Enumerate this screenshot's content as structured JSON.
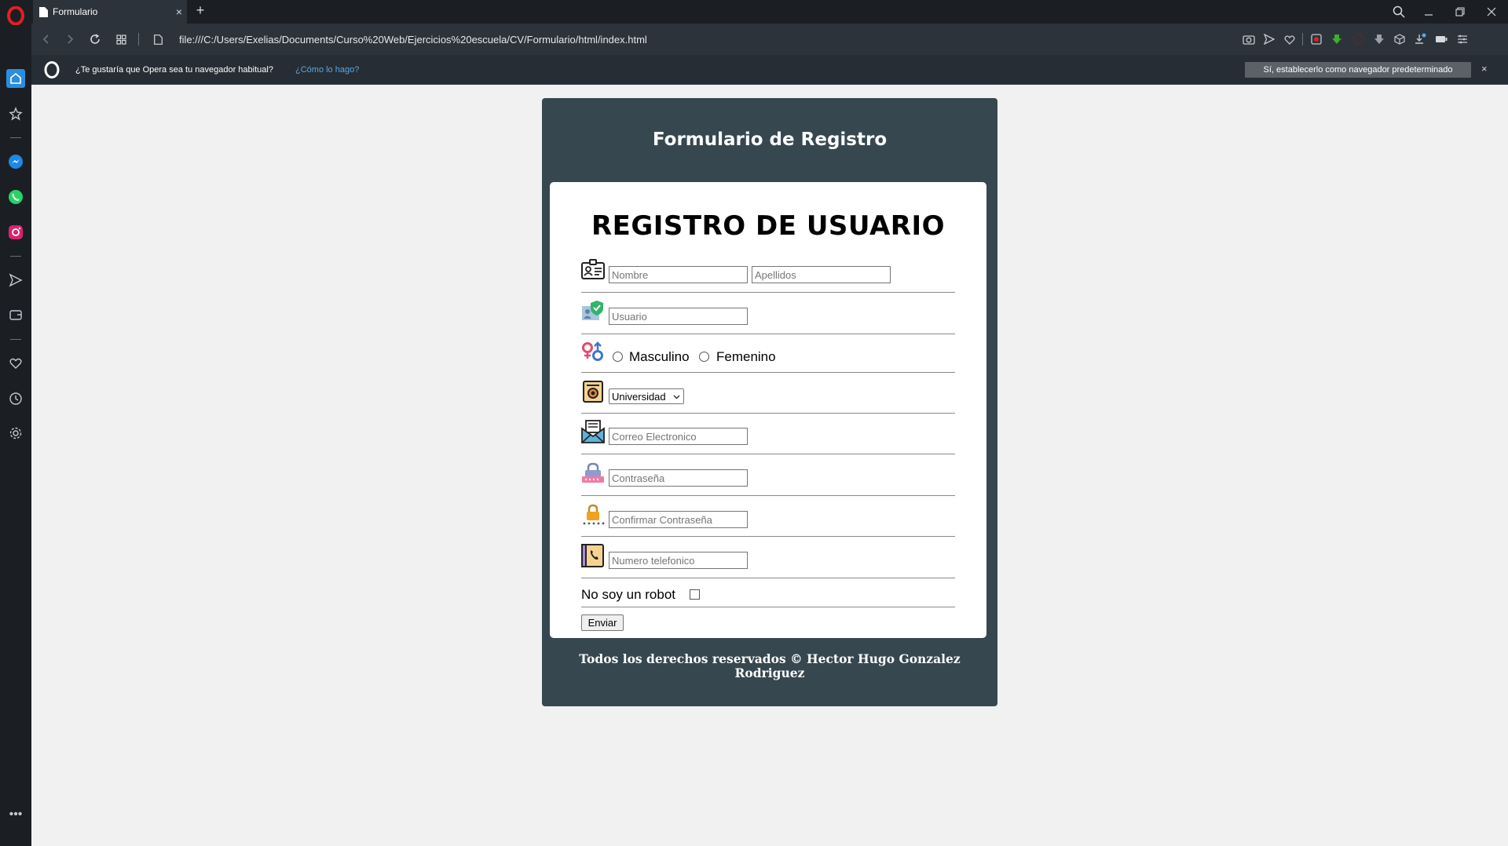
{
  "browser": {
    "tab_title": "Formulario",
    "tab_close": "×",
    "new_tab": "+",
    "url": "file:///C:/Users/Exelias/Documents/Curso%20Web/Ejercicios%20escuela/CV/Formulario/html/index.html",
    "accent_color": "#e21f26"
  },
  "infobar": {
    "message": "¿Te gustaría que Opera sea tu navegador habitual?",
    "link": "¿Cómo lo hago?",
    "default_button": "Sí, establecerlo como navegador predeterminado",
    "close": "×"
  },
  "page": {
    "card_title": "Formulario de Registro",
    "form_heading": "REGISTRO DE USUARIO",
    "fields": {
      "nombre_placeholder": "Nombre",
      "apellidos_placeholder": "Apellidos",
      "usuario_placeholder": "Usuario",
      "gender_options": [
        "Masculino",
        "Femenino"
      ],
      "university_selected": "Universidad",
      "email_placeholder": "Correo Electronico",
      "password_placeholder": "Contraseña",
      "confirm_password_placeholder": "Confirmar Contraseña",
      "phone_placeholder": "Numero telefonico"
    },
    "robot_label": "No soy un robot",
    "submit_label": "Enviar",
    "footer": "Todos los derechos reservados © Hector Hugo Gonzalez Rodriguez"
  },
  "colors": {
    "card_bg": "#37474f",
    "page_bg": "#f1f1f1",
    "sidebar_bg": "#1b1f24"
  }
}
